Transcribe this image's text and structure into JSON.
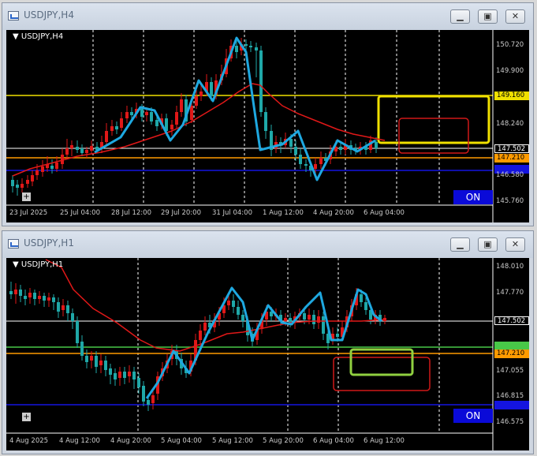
{
  "top": {
    "window_title": "USDJPY,H4",
    "symbol_label": "USDJPY,H4",
    "price_labels": [
      "150.720",
      "149.900",
      "149.160",
      "148.240",
      "147.502",
      "147.210",
      "146.580",
      "145.760"
    ],
    "hline_yellow": "149.160",
    "hline_white": "147.502",
    "hline_orange": "147.210",
    "time_labels": [
      "23 Jul 2025",
      "25 Jul 04:00",
      "28 Jul 12:00",
      "29 Jul 20:00",
      "31 Jul 04:00",
      "1 Aug 12:00",
      "4 Aug 20:00",
      "6 Aug 04:00"
    ],
    "on_label": "ON"
  },
  "bottom": {
    "window_title": "USDJPY,H1",
    "symbol_label": "USDJPY,H1",
    "price_labels": [
      "148.010",
      "147.770",
      "147.502",
      "147.210",
      "147.055",
      "146.815",
      "146.575"
    ],
    "hline_white": "147.502",
    "hline_orange": "147.210",
    "time_labels": [
      "4 Aug 2025",
      "4 Aug 12:00",
      "4 Aug 20:00",
      "5 Aug 04:00",
      "5 Aug 12:00",
      "5 Aug 20:00",
      "6 Aug 04:00",
      "6 Aug 12:00"
    ],
    "on_label": "ON"
  },
  "colors": {
    "bull": "#1fa8a8",
    "bear": "#e01818",
    "ma": "#e01818",
    "zigzag": "#1ea8e0",
    "yellow": "#f0e000",
    "orange": "#ff9b00",
    "blue": "#1414e0",
    "green": "#48c848",
    "lime": "#90d040"
  }
}
